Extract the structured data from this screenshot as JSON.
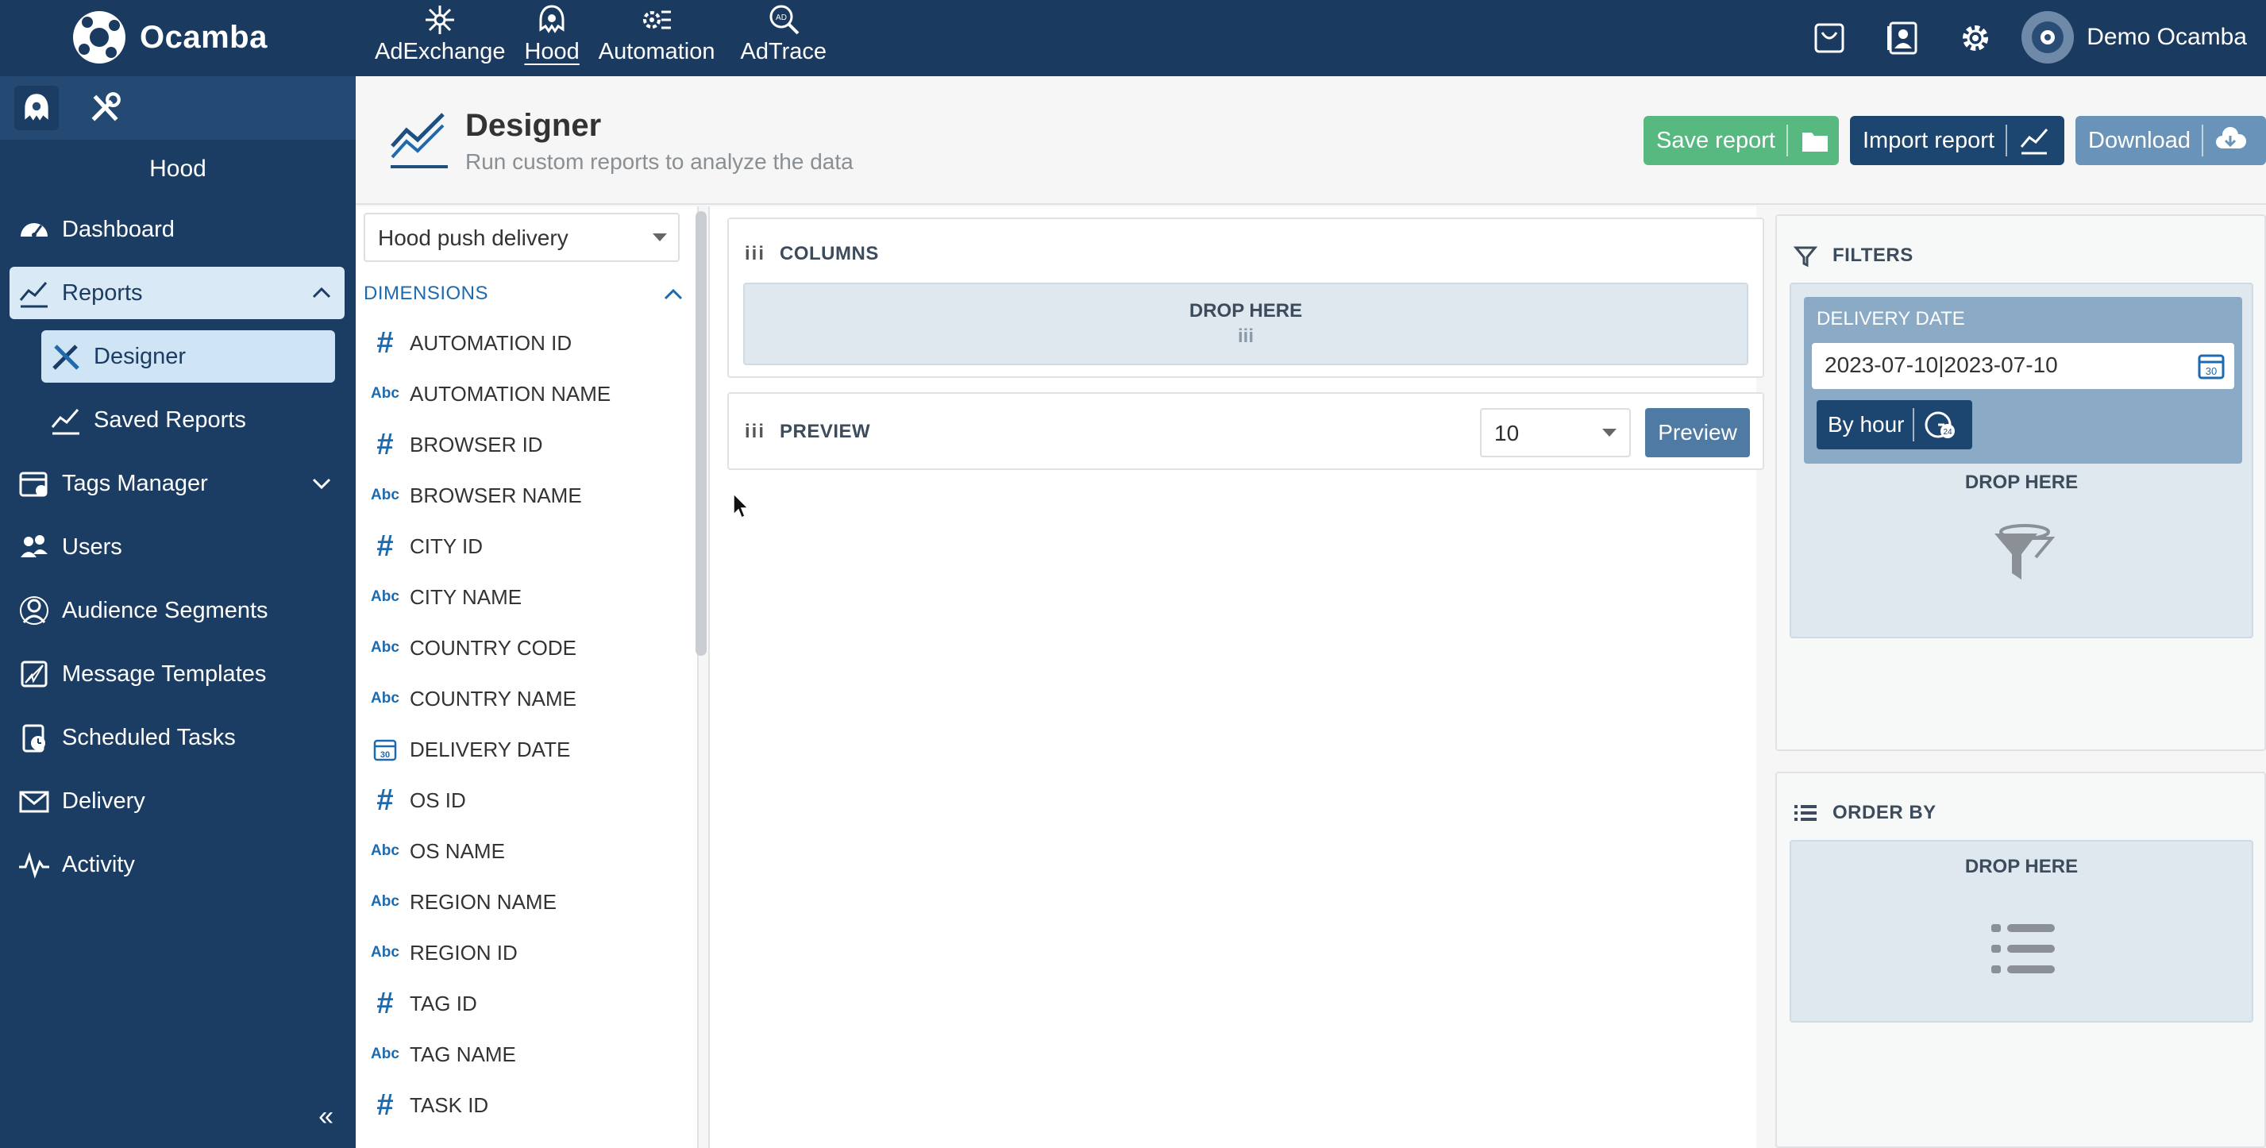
{
  "app": {
    "brand": "Ocamba"
  },
  "topnav": [
    {
      "label": "AdExchange",
      "icon": "adexchange-icon"
    },
    {
      "label": "Hood",
      "icon": "hood-icon",
      "active": true
    },
    {
      "label": "Automation",
      "icon": "automation-icon"
    },
    {
      "label": "AdTrace",
      "icon": "adtrace-icon"
    }
  ],
  "user": {
    "name": "Demo Ocamba"
  },
  "sidebar": {
    "title": "Hood",
    "items": [
      {
        "label": "Dashboard",
        "icon": "dashboard-icon"
      },
      {
        "label": "Reports",
        "icon": "reports-icon",
        "expanded": true
      },
      {
        "label": "Tags Manager",
        "icon": "tags-manager-icon"
      },
      {
        "label": "Users",
        "icon": "users-icon"
      },
      {
        "label": "Audience Segments",
        "icon": "audience-icon"
      },
      {
        "label": "Message Templates",
        "icon": "message-templates-icon"
      },
      {
        "label": "Scheduled Tasks",
        "icon": "scheduled-tasks-icon"
      },
      {
        "label": "Delivery",
        "icon": "delivery-icon"
      },
      {
        "label": "Activity",
        "icon": "activity-icon"
      }
    ],
    "reports_sub": [
      {
        "label": "Designer",
        "active": true
      },
      {
        "label": "Saved Reports"
      }
    ],
    "collapse": "«"
  },
  "header": {
    "title": "Designer",
    "subtitle": "Run custom reports to analyze the data",
    "save_label": "Save report",
    "import_label": "Import report",
    "download_label": "Download"
  },
  "dimensions": {
    "source": "Hood push delivery",
    "heading": "DIMENSIONS",
    "items": [
      {
        "type": "#",
        "label": "AUTOMATION ID"
      },
      {
        "type": "Abc",
        "label": "AUTOMATION NAME"
      },
      {
        "type": "#",
        "label": "BROWSER ID"
      },
      {
        "type": "Abc",
        "label": "BROWSER NAME"
      },
      {
        "type": "#",
        "label": "CITY ID"
      },
      {
        "type": "Abc",
        "label": "CITY NAME"
      },
      {
        "type": "Abc",
        "label": "COUNTRY CODE"
      },
      {
        "type": "Abc",
        "label": "COUNTRY NAME"
      },
      {
        "type": "date",
        "label": "DELIVERY DATE"
      },
      {
        "type": "#",
        "label": "OS ID"
      },
      {
        "type": "Abc",
        "label": "OS NAME"
      },
      {
        "type": "Abc",
        "label": "REGION NAME"
      },
      {
        "type": "Abc",
        "label": "REGION ID"
      },
      {
        "type": "#",
        "label": "TAG ID"
      },
      {
        "type": "Abc",
        "label": "TAG NAME"
      },
      {
        "type": "#",
        "label": "TASK ID"
      }
    ]
  },
  "columns": {
    "title": "COLUMNS",
    "drop": "DROP HERE",
    "drop_icon": "iii"
  },
  "preview": {
    "title": "PREVIEW",
    "limit": "10",
    "button": "Preview"
  },
  "filters": {
    "title": "FILTERS",
    "card_label": "DELIVERY DATE",
    "date_value": "2023-07-10|2023-07-10",
    "granularity": "By hour",
    "drop": "DROP HERE"
  },
  "orderby": {
    "title": "ORDER BY",
    "drop": "DROP HERE"
  },
  "colors": {
    "topbar": "#1a3a5f",
    "sidebar": "#1b3d63",
    "accent": "#1d6ab0",
    "save": "#57b97f"
  }
}
